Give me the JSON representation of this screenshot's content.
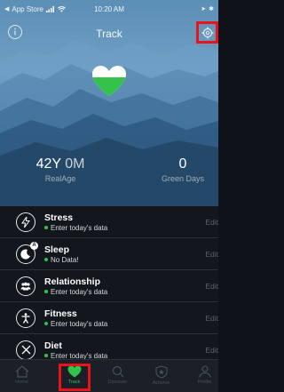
{
  "status_bar": {
    "back_app": "App Store",
    "time": "10:20 AM"
  },
  "nav": {
    "title": "Track"
  },
  "stats": {
    "real_age_years": "42Y",
    "real_age_months": "0M",
    "real_age_label": "RealAge",
    "green_days_value": "0",
    "green_days_label": "Green Days"
  },
  "rows": [
    {
      "title": "Stress",
      "subtitle": "Enter today's data",
      "edit": "Edit",
      "icon": "bolt-icon"
    },
    {
      "title": "Sleep",
      "subtitle": "No Data!",
      "edit": "Edit",
      "icon": "moon-icon",
      "badge": "A"
    },
    {
      "title": "Relationship",
      "subtitle": "Enter today's data",
      "edit": "Edit",
      "icon": "people-icon"
    },
    {
      "title": "Fitness",
      "subtitle": "Enter today's data",
      "edit": "Edit",
      "icon": "figure-icon"
    },
    {
      "title": "Diet",
      "subtitle": "Enter today's data",
      "edit": "Edit",
      "icon": "fork-knife-icon"
    }
  ],
  "tabs": [
    {
      "label": "Home",
      "icon": "home-icon"
    },
    {
      "label": "Track",
      "icon": "heart-icon"
    },
    {
      "label": "Discover",
      "icon": "search-icon"
    },
    {
      "label": "Achieve",
      "icon": "badge-icon"
    },
    {
      "label": "Profile",
      "icon": "person-icon"
    }
  ],
  "colors": {
    "accent_green": "#35c24b",
    "highlight_red": "#e8141c",
    "list_bg": "#12161d"
  }
}
